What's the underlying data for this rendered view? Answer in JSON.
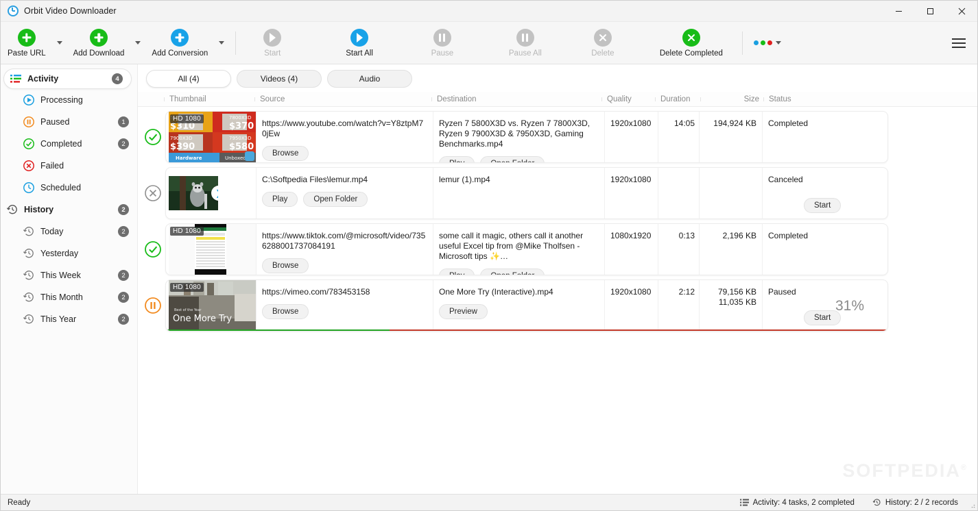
{
  "window": {
    "title": "Orbit Video Downloader",
    "app_icon": "orbit-icon",
    "minimize": "–",
    "maximize": "☐",
    "close": "✕"
  },
  "toolbar": {
    "items": [
      {
        "label": "Paste URL",
        "icon": "plus-circle-green-icon",
        "enabled": true,
        "has_caret": true
      },
      {
        "label": "Add Download",
        "icon": "plus-circle-green-icon",
        "enabled": true,
        "has_caret": true
      },
      {
        "label": "Add Conversion",
        "icon": "plus-circle-blue-icon",
        "enabled": true,
        "has_caret": true
      },
      {
        "label": "Start",
        "icon": "play-circle-icon",
        "enabled": false,
        "has_caret": false
      },
      {
        "label": "Start All",
        "icon": "play-circle-blue-icon",
        "enabled": true,
        "has_caret": false
      },
      {
        "label": "Pause",
        "icon": "pause-circle-icon",
        "enabled": false,
        "has_caret": false
      },
      {
        "label": "Pause All",
        "icon": "pause-circle-icon",
        "enabled": false,
        "has_caret": false
      },
      {
        "label": "Delete",
        "icon": "x-circle-icon",
        "enabled": false,
        "has_caret": false
      },
      {
        "label": "Delete Completed",
        "icon": "x-circle-green-icon",
        "enabled": true,
        "has_caret": false
      }
    ],
    "overflow_dots": {
      "icon": "colored-dots-menu-icon",
      "colors": [
        "#1a9fe0",
        "#18bc18",
        "#e02020"
      ]
    },
    "menu_icon": "hamburger-menu-icon"
  },
  "sidebar": {
    "groups": [
      {
        "label": "Activity",
        "icon": "activity-list-icon",
        "badge": "4",
        "selected": true,
        "children": [
          {
            "label": "Processing",
            "icon": "play-circle-blue-outline-icon",
            "badge": ""
          },
          {
            "label": "Paused",
            "icon": "pause-circle-orange-outline-icon",
            "badge": "1"
          },
          {
            "label": "Completed",
            "icon": "check-circle-green-outline-icon",
            "badge": "2"
          },
          {
            "label": "Failed",
            "icon": "x-circle-red-outline-icon",
            "badge": ""
          },
          {
            "label": "Scheduled",
            "icon": "clock-circle-blue-outline-icon",
            "badge": ""
          }
        ]
      },
      {
        "label": "History",
        "icon": "history-clock-icon",
        "badge": "2",
        "selected": false,
        "children": [
          {
            "label": "Today",
            "icon": "history-clock-icon",
            "badge": "2"
          },
          {
            "label": "Yesterday",
            "icon": "history-clock-icon",
            "badge": ""
          },
          {
            "label": "This Week",
            "icon": "history-clock-icon",
            "badge": "2"
          },
          {
            "label": "This Month",
            "icon": "history-clock-icon",
            "badge": "2"
          },
          {
            "label": "This Year",
            "icon": "history-clock-icon",
            "badge": "2"
          }
        ]
      }
    ]
  },
  "filters": [
    {
      "label": "All (4)",
      "active": true
    },
    {
      "label": "Videos (4)",
      "active": false
    },
    {
      "label": "Audio",
      "active": false
    }
  ],
  "table": {
    "columns": [
      "Thumbnail",
      "Source",
      "Destination",
      "Quality",
      "Duration",
      "Size",
      "Status"
    ],
    "rows": [
      {
        "state": "completed",
        "state_icon": "check-circle-green-icon",
        "thumb": {
          "kind": "cpu-benchmark",
          "hd_tag": "HD 1080",
          "badge": true
        },
        "source": "https://www.youtube.com/watch?v=Y8ztpM70jEw",
        "source_buttons": [
          "Browse"
        ],
        "destination": "Ryzen 7 5800X3D vs. Ryzen 7 7800X3D, Ryzen 9 7900X3D & 7950X3D, Gaming Benchmarks.mp4",
        "destination_buttons": [
          "Play",
          "Open Folder"
        ],
        "quality": "1920x1080",
        "duration": "14:05",
        "size": "194,924 KB",
        "size2": "",
        "status": "Completed",
        "status_button": "",
        "percent": "",
        "progress": 0
      },
      {
        "state": "canceled",
        "state_icon": "x-circle-grey-icon",
        "thumb": {
          "kind": "lemur-conversion",
          "hd_tag": "",
          "badge": false
        },
        "source": "C:\\Softpedia Files\\lemur.mp4",
        "source_buttons": [
          "Play",
          "Open Folder"
        ],
        "destination": "lemur (1).mp4",
        "destination_buttons": [],
        "quality": "1920x1080",
        "duration": "",
        "size": "",
        "size2": "",
        "status": "Canceled",
        "status_button": "Start",
        "percent": "",
        "progress": 0
      },
      {
        "state": "completed",
        "state_icon": "check-circle-green-icon",
        "thumb": {
          "kind": "excel-tiktok",
          "hd_tag": "HD 1080",
          "badge": false
        },
        "source": "https://www.tiktok.com/@microsoft/video/7356288001737084191",
        "source_buttons": [
          "Browse"
        ],
        "destination": "some call it magic, others call it another useful Excel tip from @Mike Tholfsen - Microsoft tips ✨…",
        "destination_buttons": [
          "Play",
          "Open Folder"
        ],
        "quality": "1080x1920",
        "duration": "0:13",
        "size": "2,196 KB",
        "size2": "",
        "status": "Completed",
        "status_button": "",
        "percent": "",
        "progress": 0
      },
      {
        "state": "paused",
        "state_icon": "pause-circle-orange-icon",
        "thumb": {
          "kind": "one-more-try",
          "hd_tag": "HD 1080",
          "badge": false,
          "caption_small": "Best of the Year",
          "caption_big": "One More Try"
        },
        "source": "https://vimeo.com/783453158",
        "source_buttons": [
          "Browse"
        ],
        "destination": "One More Try (Interactive).mp4",
        "destination_buttons": [
          "Preview"
        ],
        "quality": "1920x1080",
        "duration": "2:12",
        "size": "79,156 KB",
        "size2": "11,035 KB",
        "status": "Paused",
        "status_button": "Start",
        "percent": "31%",
        "progress": 31
      }
    ]
  },
  "watermark": {
    "text": "SOFTPEDIA",
    "mark": "®"
  },
  "statusbar": {
    "left": "Ready",
    "activity": "Activity: 4 tasks, 2 completed",
    "activity_icon": "activity-list-icon",
    "history": "History: 2 / 2 records",
    "history_icon": "history-clock-icon"
  }
}
